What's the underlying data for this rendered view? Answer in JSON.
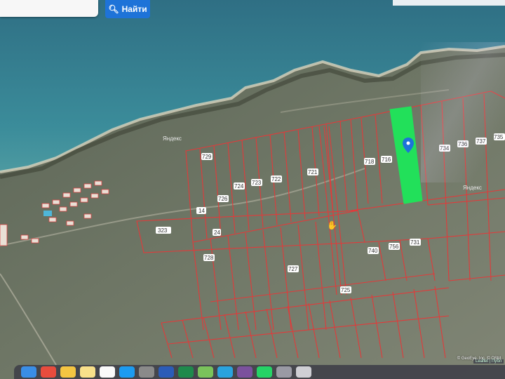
{
  "search": {
    "button_label": "Найти",
    "icon": "search-icon"
  },
  "map": {
    "provider_label": "Яндекс",
    "provider_label_2": "Яндекс",
    "selected_color": "#22e05a",
    "boundary_color": "#e23a3a",
    "marker_color": "#1e73d8",
    "plot_labels": {
      "p323": "323",
      "p14": "14",
      "p729": "729",
      "p726": "726",
      "p724": "724",
      "p723": "723",
      "p722": "722",
      "p721": "721",
      "p718": "718",
      "p716": "716",
      "p740": "740",
      "p756": "756",
      "p731": "731",
      "p734": "734",
      "p735": "735",
      "p736": "736",
      "p737": "737",
      "p728": "728",
      "p727": "727",
      "p725": "725",
      "p24": "24"
    }
  },
  "attribution": {
    "text": "© GeoEye, Inc. © OSM",
    "leaflet": "Leaflet | Публ"
  },
  "dock": {
    "apps": [
      "finder-icon",
      "chrome-icon",
      "photos-icon",
      "notes-icon",
      "calendar-icon",
      "appstore-icon",
      "settings-icon",
      "word-icon",
      "excel-icon",
      "maps-icon",
      "telegram-icon",
      "viber-icon",
      "whatsapp-icon",
      "files-icon",
      "trash-icon"
    ]
  }
}
